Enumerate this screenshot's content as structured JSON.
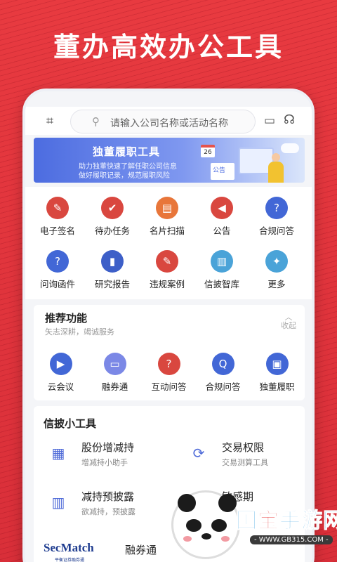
{
  "headline": "董办高效办公工具",
  "search": {
    "placeholder": "请输入公司名称或活动名称"
  },
  "banner": {
    "title": "独董履职工具",
    "line1": "助力独董快速了解任职公司信息",
    "line2": "做好履职记录，规范履职风险",
    "calendar_day": "26",
    "doc_label": "公告"
  },
  "grid": [
    {
      "label": "电子签名",
      "icon": "pen-icon",
      "color": "#d9473f",
      "glyph": "✎"
    },
    {
      "label": "待办任务",
      "icon": "task-icon",
      "color": "#d9473f",
      "glyph": "✔"
    },
    {
      "label": "名片扫描",
      "icon": "card-scan-icon",
      "color": "#e8763a",
      "glyph": "▤"
    },
    {
      "label": "公告",
      "icon": "megaphone-icon",
      "color": "#d9473f",
      "glyph": "◀"
    },
    {
      "label": "合规问答",
      "icon": "qa-icon",
      "color": "#4267d6",
      "glyph": "?"
    },
    {
      "label": "问询函件",
      "icon": "inquiry-icon",
      "color": "#4267d6",
      "glyph": "?"
    },
    {
      "label": "研究报告",
      "icon": "report-icon",
      "color": "#3d5fc8",
      "glyph": "▮"
    },
    {
      "label": "违规案例",
      "icon": "violation-icon",
      "color": "#d9473f",
      "glyph": "✎"
    },
    {
      "label": "信披智库",
      "icon": "library-icon",
      "color": "#4aa3d8",
      "glyph": "▥"
    },
    {
      "label": "更多",
      "icon": "more-icon",
      "color": "#4aa3d8",
      "glyph": "✦"
    }
  ],
  "recommend": {
    "title": "推荐功能",
    "subtitle": "矢志深耕，竭诚服务",
    "collapse_label": "收起",
    "items": [
      {
        "label": "云会议",
        "icon": "video-icon",
        "color": "#4267d6",
        "glyph": "▶"
      },
      {
        "label": "融券通",
        "icon": "bank-icon",
        "color": "#7b88e6",
        "glyph": "▭"
      },
      {
        "label": "互动问答",
        "icon": "chat-icon",
        "color": "#d9473f",
        "glyph": "?"
      },
      {
        "label": "合规问答",
        "icon": "qa-icon",
        "color": "#4267d6",
        "glyph": "Q"
      },
      {
        "label": "独董履职",
        "icon": "id-icon",
        "color": "#4267d6",
        "glyph": "▣"
      }
    ]
  },
  "tools": {
    "title": "信披小工具",
    "items": [
      {
        "name": "股份增减持",
        "desc": "增减持小助手",
        "icon": "chart-icon",
        "glyph": "▦"
      },
      {
        "name": "交易权限",
        "desc": "交易测算工具",
        "icon": "exchange-icon",
        "glyph": "⟳"
      },
      {
        "name": "减持预披露",
        "desc": "欲减持，预披露",
        "icon": "bar-chart-icon",
        "glyph": "▥"
      },
      {
        "name": "敏感期",
        "desc": "",
        "icon": "alert-icon",
        "glyph": "▲"
      }
    ]
  },
  "bottom_card": {
    "logo": "SecMatch",
    "logo_sub": "平衡证券融券通",
    "label": "融券通"
  },
  "watermark": {
    "title_prefix": "国",
    "title_accent": "宝",
    "title_rest": "手游网",
    "url": "- WWW.GB315.COM -"
  }
}
